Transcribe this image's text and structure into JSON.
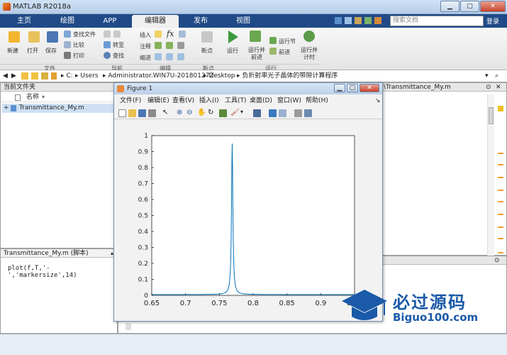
{
  "window": {
    "title": "MATLAB R2018a"
  },
  "tabs": [
    "主页",
    "绘图",
    "APP",
    "编辑器",
    "发布",
    "视图"
  ],
  "search": {
    "placeholder": "搜索文档",
    "login": "登录"
  },
  "toolstrip": {
    "file": {
      "new": "新建",
      "open": "打开",
      "save": "保存",
      "find_files": "查找文件",
      "compare": "比较",
      "print": "打印",
      "group": "文件"
    },
    "nav": {
      "goto": "转至",
      "find": "查找",
      "group": "导航"
    },
    "edit": {
      "insert": "插入",
      "comment": "注释",
      "indent": "缩进",
      "fx": "fx",
      "group": "编辑"
    },
    "breakpoints": {
      "bp": "断点",
      "group": "断点"
    },
    "run": {
      "run": "运行",
      "run_advance": "运行并\n前进",
      "run_section": "运行节",
      "advance": "前进",
      "run_time": "运行并\n计时",
      "group": "运行"
    }
  },
  "address": {
    "parts": [
      "C:",
      "Users",
      "Administrator.WIN7U-20180127Z",
      "Desktop",
      "负折射率光子晶体的带隙计算程序"
    ]
  },
  "current_folder": {
    "title": "当前文件夹",
    "col_name": "名称",
    "file": "Transmittance_My.m"
  },
  "details": {
    "title": "Transmittance_My.m  (脚本)",
    "code": "plot(f,T,'-','markersize',14)"
  },
  "editor_tab": {
    "title": "\\Transmittance_My.m"
  },
  "figure": {
    "title": "Figure 1",
    "menu": [
      "文件(F)",
      "编辑(E)",
      "查看(V)",
      "插入(I)",
      "工具(T)",
      "桌面(D)",
      "窗口(W)",
      "帮助(H)"
    ]
  },
  "chart_data": {
    "type": "line",
    "title": "",
    "xlabel": "",
    "ylabel": "",
    "xlim": [
      0.65,
      0.95
    ],
    "ylim": [
      0,
      1
    ],
    "xticks": [
      "0.65",
      "0.7",
      "0.75",
      "0.8",
      "0.85",
      "0.9",
      "0.95"
    ],
    "yticks": [
      "0",
      "0.1",
      "0.2",
      "0.3",
      "0.4",
      "0.5",
      "0.6",
      "0.7",
      "0.8",
      "0.9",
      "1"
    ],
    "grid": false,
    "series": [
      {
        "color": "#0072bd",
        "peak_x": 0.769,
        "peak_y": 0.95,
        "baseline": 0.005
      }
    ]
  },
  "logo": {
    "title": "必过源码",
    "url": "Biguo100.com"
  }
}
